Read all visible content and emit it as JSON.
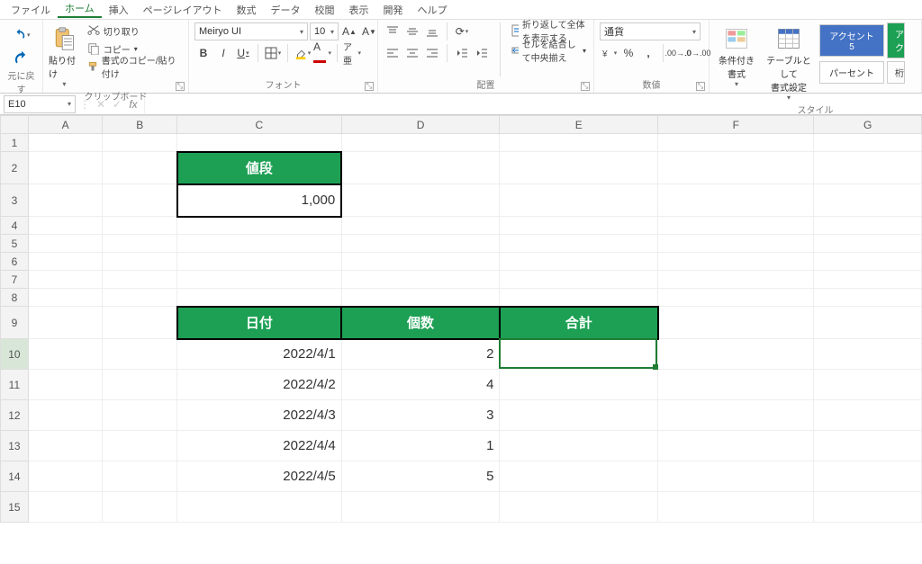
{
  "tabs": {
    "file": "ファイル",
    "home": "ホーム",
    "insert": "挿入",
    "pageLayout": "ページレイアウト",
    "formulas": "数式",
    "data": "データ",
    "review": "校閲",
    "view": "表示",
    "developer": "開発",
    "help": "ヘルプ"
  },
  "ribbon": {
    "undoGroup": "元に戻す",
    "clipboard": {
      "paste": "貼り付け",
      "cut": "切り取り",
      "copy": "コピー",
      "formatPainter": "書式のコピー/貼り付け",
      "label": "クリップボード"
    },
    "font": {
      "name": "Meiryo UI",
      "size": "10",
      "label": "フォント"
    },
    "alignment": {
      "wrap": "折り返して全体を表示する",
      "merge": "セルを結合して中央揃え",
      "label": "配置"
    },
    "number": {
      "format": "通貨",
      "label": "数値"
    },
    "styles": {
      "cond": "条件付き\n書式",
      "table": "テーブルとして\n書式設定",
      "accent5": "アクセント 5",
      "percent": "パーセント",
      "label": "スタイル",
      "moreAccent": "アク",
      "moreFormat": "桁"
    }
  },
  "formulaBar": {
    "nameBox": "E10",
    "formula": ""
  },
  "columns": [
    "A",
    "B",
    "C",
    "D",
    "E",
    "F",
    "G"
  ],
  "sheet": {
    "priceHeader": "値段",
    "priceValue": "1,000",
    "dateHeader": "日付",
    "countHeader": "個数",
    "totalHeader": "合計",
    "rows": [
      {
        "date": "2022/4/1",
        "count": "2"
      },
      {
        "date": "2022/4/2",
        "count": "4"
      },
      {
        "date": "2022/4/3",
        "count": "3"
      },
      {
        "date": "2022/4/4",
        "count": "1"
      },
      {
        "date": "2022/4/5",
        "count": "5"
      }
    ]
  }
}
